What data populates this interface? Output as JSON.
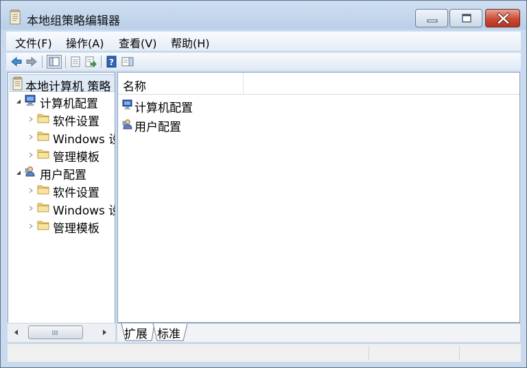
{
  "window": {
    "title": "本地组策略编辑器",
    "close_glyph": "✕"
  },
  "menubar": {
    "items": [
      {
        "label": "文件(F)"
      },
      {
        "label": "操作(A)"
      },
      {
        "label": "查看(V)"
      },
      {
        "label": "帮助(H)"
      }
    ]
  },
  "toolbar": {
    "buttons": [
      "back-icon",
      "forward-icon",
      "show-hide-tree-icon",
      "properties-icon",
      "export-list-icon",
      "help-icon",
      "show-action-pane-icon"
    ]
  },
  "tree": {
    "root": "本地计算机 策略",
    "nodes": [
      {
        "label": "计算机配置",
        "expanded": true,
        "children": [
          "软件设置",
          "Windows 设置",
          "管理模板"
        ]
      },
      {
        "label": "用户配置",
        "expanded": true,
        "children": [
          "软件设置",
          "Windows 设置",
          "管理模板"
        ]
      }
    ]
  },
  "list": {
    "column_header": "名称",
    "items": [
      "计算机配置",
      "用户配置"
    ]
  },
  "tabs": [
    {
      "label": "扩展",
      "active": false
    },
    {
      "label": "标准",
      "active": true
    }
  ],
  "colors": {
    "frame": "#c9daee",
    "selection": "#dfeaf7",
    "folder": "#f2d37a"
  }
}
